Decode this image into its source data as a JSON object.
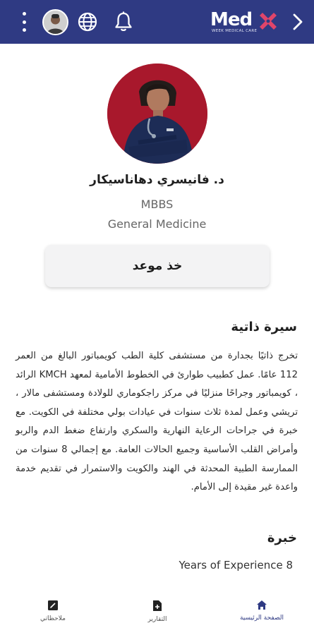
{
  "header": {
    "logo_text": "Med",
    "logo_tagline": "WEEK MEDICAL CARE",
    "icons": [
      "more-vert-icon",
      "user-avatar",
      "globe-icon",
      "bell-icon",
      "chevron-right-icon"
    ]
  },
  "colors": {
    "header_bg": "#2f3a83",
    "logo_x": "#e0456a",
    "photo_bg": "#a8182c",
    "active_nav": "#2f3a83"
  },
  "doctor": {
    "name": "د. فانيسري دهاناسيكار",
    "degree": "MBBS",
    "specialty": "General Medicine"
  },
  "actions": {
    "book_label": "خذ موعد"
  },
  "bio": {
    "title": "سيرة ذاتية",
    "text": "تخرج ذاتيًا بجدارة من مستشفى كلية الطب كويمباتور البالغ من العمر 112 عامًا. عمل كطبيب طوارئ في الخطوط الأمامية لمعهد KMCH الرائد ، كويمباتور وجراحًا منزليًا في مركز راجكوماري للولادة ومستشفى مالار ، تريشي وعمل لمدة ثلاث سنوات في عيادات بولي مختلفة في الكويت. مع خبرة في جراحات الرعاية النهارية والسكري وارتفاع ضغط الدم والربو وأمراض القلب الأساسية وجميع الحالات العامة. مع إجمالي 8 سنوات من الممارسة الطبية المحدثة في الهند والكويت والاستمرار في تقديم خدمة واعدة غير مقيدة إلى الأمام."
  },
  "experience": {
    "title": "خبرة",
    "value": "Years of Experience 8"
  },
  "bottom_nav": {
    "notes": "ملاحظاتي",
    "reports": "التقارير",
    "home": "الصفحة الرئيسية"
  }
}
